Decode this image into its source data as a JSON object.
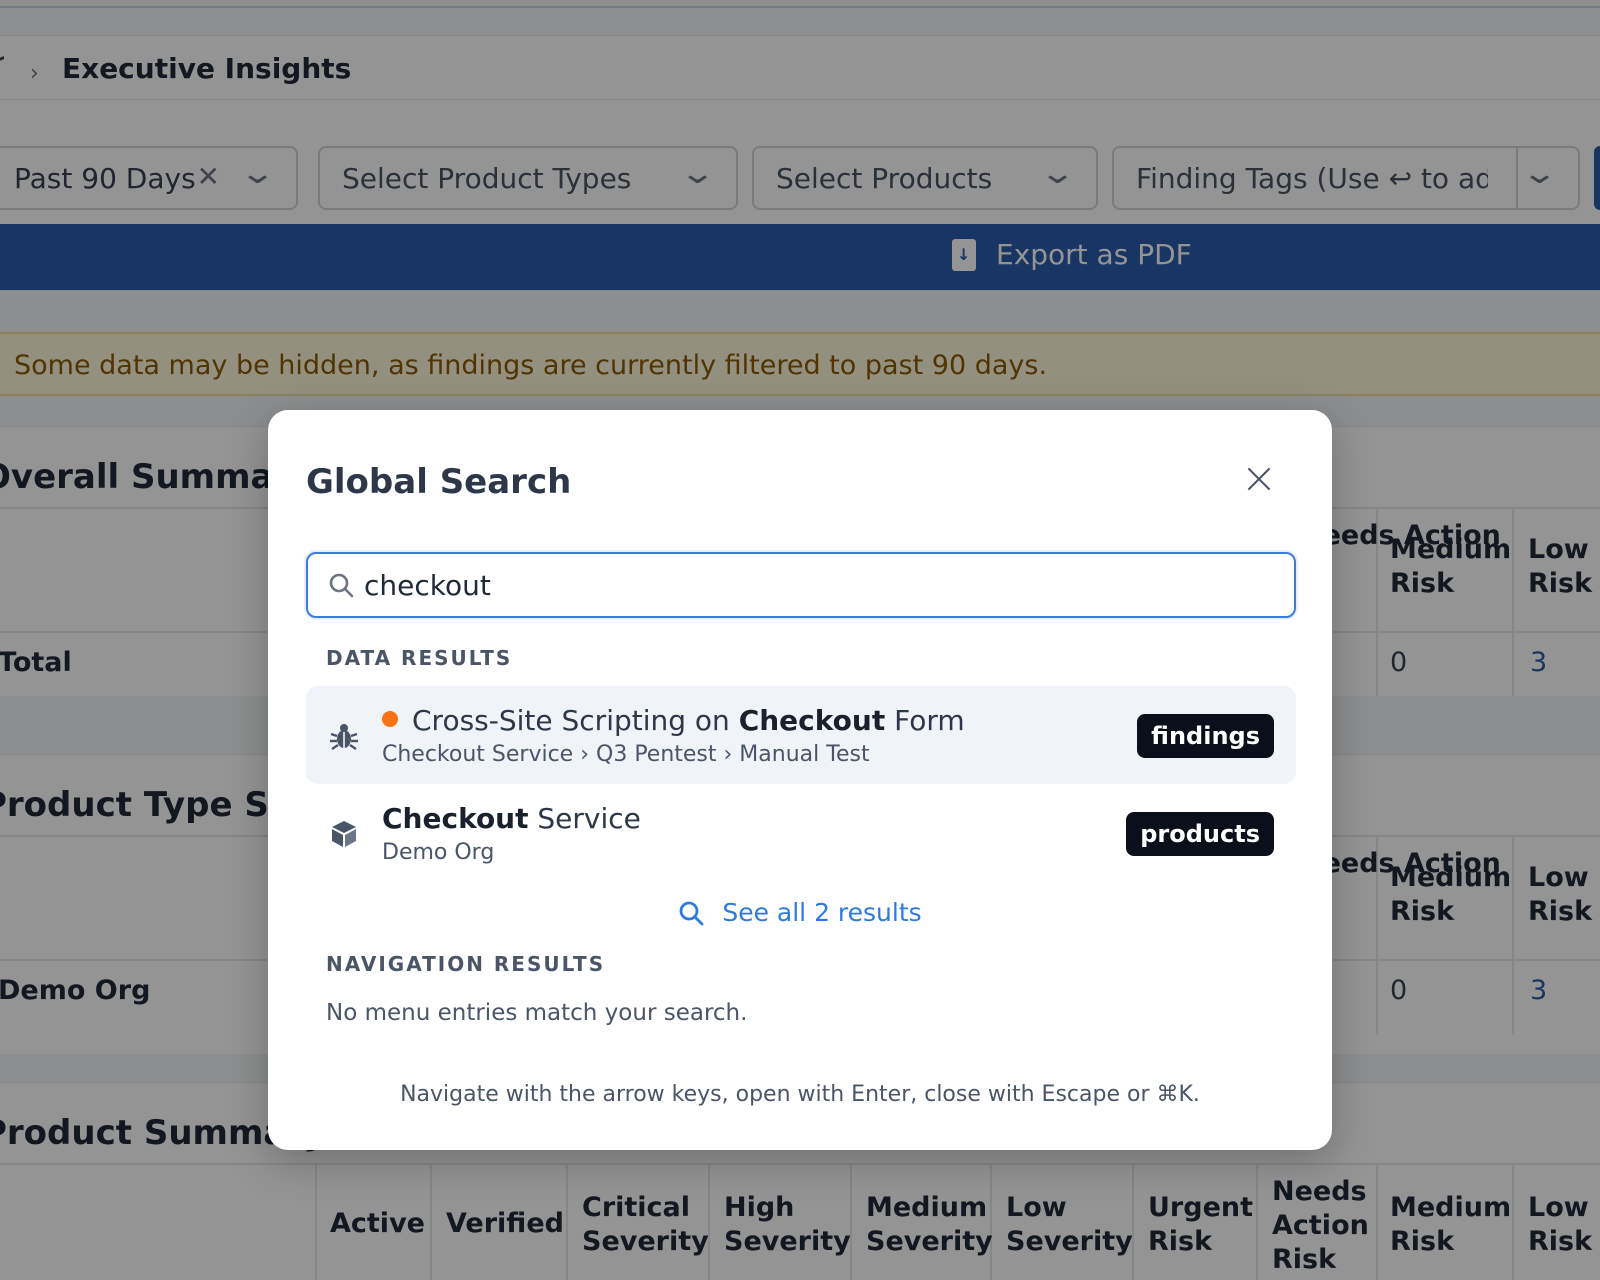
{
  "breadcrumb": {
    "current": "Executive Insights"
  },
  "filters": {
    "date_range": "Past 90 Days",
    "product_types_placeholder": "Select Product Types",
    "products_placeholder": "Select Products",
    "finding_tags_placeholder": "Finding Tags (Use ↩ to add)"
  },
  "export": {
    "label": "Export as PDF"
  },
  "alert": {
    "text": "Some data may be hidden, as findings are currently filtered to past 90 days."
  },
  "sections": {
    "overall": {
      "title": "Overall Summary",
      "row_label": "Total",
      "headers": [
        "Needs Action",
        "Medium Risk",
        "Low Risk"
      ],
      "values": [
        "0",
        "3"
      ]
    },
    "product_type": {
      "title": "Product Type Summary",
      "row_label": "Demo Org",
      "headers": [
        "Needs Action",
        "Medium Risk",
        "Low Risk"
      ],
      "values": [
        "0",
        "3"
      ]
    },
    "product": {
      "title": "Product Summary",
      "headers": [
        "Active",
        "Verified",
        "Critical Severity",
        "High Severity",
        "Medium Severity",
        "Low Severity",
        "Urgent Risk",
        "Needs Action Risk",
        "Medium Risk",
        "Low Risk"
      ]
    }
  },
  "modal": {
    "title": "Global Search",
    "query": "checkout",
    "data_results_label": "DATA RESULTS",
    "results": [
      {
        "title_pre": "Cross-Site Scripting on ",
        "title_match": "Checkout",
        "title_post": " Form",
        "subtitle": "Checkout Service › Q3 Pentest › Manual Test",
        "tag": "findings",
        "icon": "bug-icon",
        "status_color": "#f97316"
      },
      {
        "title_pre": "",
        "title_match": "Checkout",
        "title_post": " Service",
        "subtitle": "Demo Org",
        "tag": "products",
        "icon": "cube-icon"
      }
    ],
    "see_all": "See all 2 results",
    "navigation_results_label": "NAVIGATION RESULTS",
    "navigation_empty": "No menu entries match your search.",
    "hint": "Navigate with the arrow keys, open with Enter, close with Escape or ⌘K."
  },
  "colors": {
    "accent": "#2a5cac",
    "link": "#2d7be0",
    "alert_text": "#8a5a05",
    "tag_bg": "#0b0f19"
  }
}
